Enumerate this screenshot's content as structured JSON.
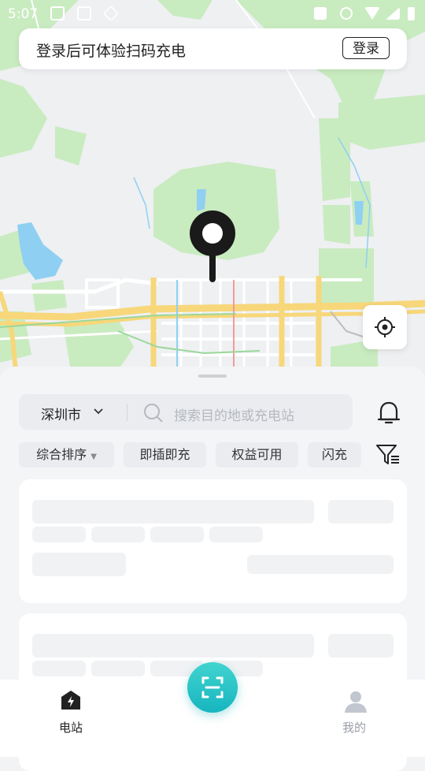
{
  "status_bar": {
    "time": "5:07"
  },
  "login_banner": {
    "message": "登录后可体验扫码充电",
    "login_button": "登录"
  },
  "map": {
    "icons": [
      "location-pin-icon",
      "locate-icon"
    ]
  },
  "search": {
    "city": "深圳市",
    "placeholder": "搜索目的地或充电站"
  },
  "filters": [
    "综合排序",
    "即插即充",
    "权益可用",
    "闪充"
  ],
  "tabbar": {
    "station": "电站",
    "mine": "我的"
  },
  "colors": {
    "accent": "#1fbcc4",
    "map_green": "#c9ebc0",
    "road_yellow": "#f7d77a",
    "water": "#8fd0f2"
  }
}
